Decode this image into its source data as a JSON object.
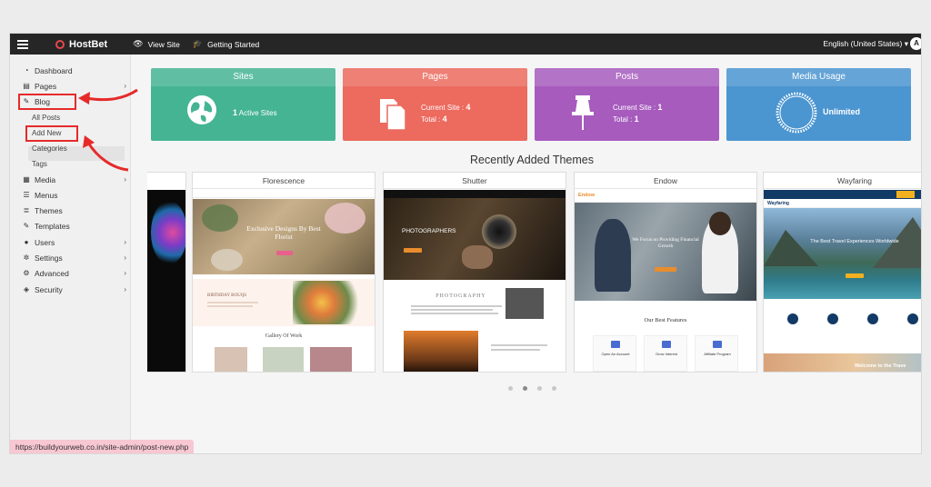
{
  "topbar": {
    "brand": "HostBet",
    "links": [
      "View Site",
      "Getting Started"
    ],
    "language": "English (United States)",
    "avatar": "A"
  },
  "sidebar": {
    "items": [
      {
        "label": "Dashboard",
        "icon": "dashboard-icon",
        "chevron": false
      },
      {
        "label": "Pages",
        "icon": "pages-icon",
        "chevron": true
      },
      {
        "label": "Blog",
        "icon": "pin-icon",
        "chevron": false
      },
      {
        "label": "Media",
        "icon": "media-icon",
        "chevron": true
      },
      {
        "label": "Menus",
        "icon": "menus-icon",
        "chevron": false
      },
      {
        "label": "Themes",
        "icon": "themes-icon",
        "chevron": false
      },
      {
        "label": "Templates",
        "icon": "templates-icon",
        "chevron": false
      },
      {
        "label": "Users",
        "icon": "users-icon",
        "chevron": true
      },
      {
        "label": "Settings",
        "icon": "settings-icon",
        "chevron": true
      },
      {
        "label": "Advanced",
        "icon": "advanced-icon",
        "chevron": true
      },
      {
        "label": "Security",
        "icon": "shield-icon",
        "chevron": true
      }
    ],
    "blog_sub": [
      "All Posts",
      "Add New",
      "Categories",
      "Tags"
    ]
  },
  "cards": {
    "sites": {
      "title": "Sites",
      "count": "1",
      "label": "Active Sites",
      "color": "#45b493"
    },
    "pages": {
      "title": "Pages",
      "current_label": "Current Site :",
      "current": "4",
      "total_label": "Total :",
      "total": "4",
      "color": "#ec6a5e"
    },
    "posts": {
      "title": "Posts",
      "current_label": "Current Site :",
      "current": "1",
      "total_label": "Total :",
      "total": "1",
      "color": "#a65bbd"
    },
    "media": {
      "title": "Media Usage",
      "value": "Unlimited",
      "color": "#4b95d0"
    }
  },
  "themes": {
    "heading": "Recently Added Themes",
    "items": [
      "Florescence",
      "Shutter",
      "Endow",
      "Wayfaring"
    ],
    "florescence": {
      "hero": "Exclusive Designs By Best Florist",
      "section": "BIRTHDAY BOUQS",
      "gallery": "Gallery Of Work"
    },
    "shutter": {
      "hero": "PHOTOGRAPHERS",
      "brand": "PHOTOGRAPHY"
    },
    "endow": {
      "logo": "Endow",
      "hero": "We Focus on Providing Financial Growth",
      "features": "Our Best Features",
      "f1": "Open An Account",
      "f2": "Grow Interest",
      "f3": "Affiliate Program"
    },
    "wayfaring": {
      "logo": "Wayfaring",
      "hero": "The Best Travel Experiences Worldwide",
      "footer": "Welcome to the Trave"
    }
  },
  "status_url": "https://buildyourweb.co.in/site-admin/post-new.php",
  "colors": {
    "highlight": "#e62a2a",
    "topbar": "#262626"
  }
}
